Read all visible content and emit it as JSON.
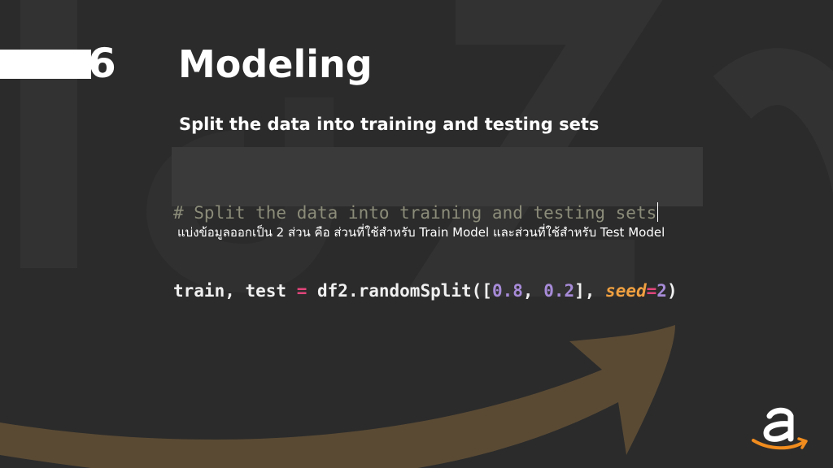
{
  "slide": {
    "number": "6",
    "title": "Modeling"
  },
  "subtitle": "Split the data into training and testing sets",
  "code": {
    "comment": "# Split the data into training and testing sets",
    "line2": {
      "vars": "train, test ",
      "assign": "=",
      "call": " df2.randomSplit([",
      "n1": "0.8",
      "sep": ", ",
      "n2": "0.2",
      "mid": "], ",
      "kw": "seed",
      "eq": "=",
      "n3": "2",
      "end": ")"
    }
  },
  "description": "แบ่งข้อมูลออกเป็น 2 ส่วน คือ ส่วนที่ใช้สำหรับ Train Model และส่วนที่ใช้สำหรับ Test Model",
  "colors": {
    "background": "#2b2b2b",
    "swoosh": "#5a4a34",
    "logo_text": "#ffffff",
    "logo_arrow": "#f08c1e"
  },
  "icons": {
    "logo": "amazon-logo-icon"
  }
}
